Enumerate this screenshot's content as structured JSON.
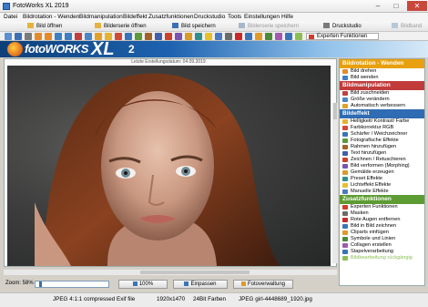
{
  "window": {
    "title": "FotoWorks XL 2019"
  },
  "menu": [
    "Datei",
    "Bildrotation - Wenden",
    "Bildmanipulation",
    "Bildeffekt",
    "Zusatzfunktionen",
    "Druckstudio",
    "Tools",
    "Einstellungen",
    "Hilfe"
  ],
  "toolbar": {
    "open": "Bild öffnen",
    "series": "Bilderserie öffnen",
    "save": "Bild speichern",
    "save_series": "Bilderserie speichern",
    "print": "Druckstudio",
    "photo_book": "Bildband"
  },
  "extended_functions": "Experten Funktionen",
  "banner": {
    "brand_italic": "fotoWORKS",
    "brand_xl": "XL",
    "brand_version": "2"
  },
  "last_updated": "Letzte Erstellungsdatum: 04.09.2019",
  "panel": {
    "sections": [
      {
        "title": "Bildrotation - Wenden",
        "color": "#e8a00e",
        "items": [
          {
            "label": "Bild drehen",
            "icon": "rotate-icon",
            "color": "#e38b2c"
          },
          {
            "label": "Bild wenden",
            "icon": "flip-icon",
            "color": "#3d7fc1"
          }
        ]
      },
      {
        "title": "Bildmanipulation",
        "color": "#c23b3b",
        "items": [
          {
            "label": "Bild zuschneiden",
            "icon": "crop-icon",
            "color": "#c04040"
          },
          {
            "label": "Größe verändern",
            "icon": "resize-icon",
            "color": "#4a86c8"
          },
          {
            "label": "Automatisch verbessern",
            "icon": "auto-enhance-icon",
            "color": "#e0a02a"
          }
        ]
      },
      {
        "title": "Bildeffekt",
        "color": "#2f6cb3",
        "items": [
          {
            "label": "Helligkeit/ Kontrast/ Farbe",
            "icon": "brightness-icon",
            "color": "#e3b230"
          },
          {
            "label": "Farbkorrektur RGB",
            "icon": "rgb-icon",
            "color": "#d04a3a"
          },
          {
            "label": "Schärfer / Weichzeichner",
            "icon": "sharpen-icon",
            "color": "#3a74b8"
          },
          {
            "label": "Fotografische Effekte",
            "icon": "photo-effects-icon",
            "color": "#5a9a3a"
          },
          {
            "label": "Rahmen hinzufügen",
            "icon": "frame-icon",
            "color": "#a0622a"
          },
          {
            "label": "Text hinzufügen",
            "icon": "text-icon",
            "color": "#3f5fa8"
          },
          {
            "label": "Zeichnen / Retuschieren",
            "icon": "draw-icon",
            "color": "#c8422e"
          },
          {
            "label": "Bild verformen (Morphing)",
            "icon": "morph-icon",
            "color": "#7a54b0"
          },
          {
            "label": "Gemälde erzeugen",
            "icon": "painting-icon",
            "color": "#d99a2a"
          },
          {
            "label": "Preset Effekte",
            "icon": "preset-icon",
            "color": "#2f8f8f"
          },
          {
            "label": "Lichteffekt Effekte",
            "icon": "light-icon",
            "color": "#e6c02c"
          },
          {
            "label": "Manuelle Effekte",
            "icon": "manual-icon",
            "color": "#4a7ac0"
          }
        ]
      },
      {
        "title": "Zusatzfunktionen",
        "color": "#5d9b33",
        "items": [
          {
            "label": "Experten Funktionen",
            "icon": "expert-icon",
            "color": "#d43a2a"
          },
          {
            "label": "Masken",
            "icon": "mask-icon",
            "color": "#6a6a6a"
          },
          {
            "label": "Rote Augen entfernen",
            "icon": "red-eye-icon",
            "color": "#c82828"
          },
          {
            "label": "Bild in Bild zeichnen",
            "icon": "picture-in-picture-icon",
            "color": "#3a74b8"
          },
          {
            "label": "Cliparts einfügen",
            "icon": "clipart-icon",
            "color": "#e09a2a"
          },
          {
            "label": "Symbole und Linien",
            "icon": "symbols-icon",
            "color": "#4a8a3a"
          },
          {
            "label": "Collagen erstellen",
            "icon": "collage-icon",
            "color": "#a05ab0"
          },
          {
            "label": "Stapelverarbeitung",
            "icon": "batch-icon",
            "color": "#3a74b8"
          },
          {
            "label": "Bildbearbeitung rückgängig",
            "icon": "undo-icon",
            "color": "#8bbf53",
            "disabled": true
          }
        ]
      }
    ]
  },
  "zoom": {
    "label": "Zoom: 58%",
    "value": 58,
    "fit_label": "100%",
    "fit_window": "Einpassen",
    "photo_mgmt": "Fotoverwaltung"
  },
  "status": {
    "format": "JPEG 4:1:1 compressed Exif file",
    "dimensions": "1920x1470",
    "color_depth": "24Bit Farben",
    "file": "JPEG girl-4448689_1920.jpg"
  }
}
